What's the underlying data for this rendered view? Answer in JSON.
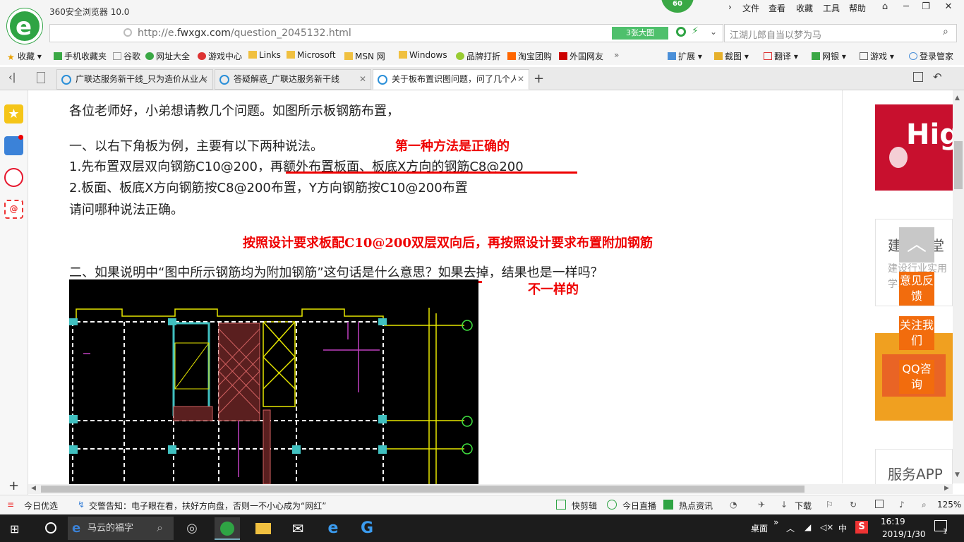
{
  "app": {
    "title": "360安全浏览器 10.0",
    "badge": "60"
  },
  "menu": [
    "文件",
    "查看",
    "收藏",
    "工具",
    "帮助"
  ],
  "address": {
    "url_prefix": "http://e.",
    "url_domain": "fwxgx.com",
    "url_path": "/question_2045132.html",
    "bigpic_label": "3张大图",
    "search_text": "江湖儿郎自当以梦为马"
  },
  "bookmarks": [
    "收藏",
    "手机收藏夹",
    "谷歌",
    "网址大全",
    "游戏中心",
    "Links",
    "Microsoft",
    "MSN 网",
    "Windows",
    "品牌打折",
    "淘宝团购",
    "外国网友"
  ],
  "toolbar_right": [
    "扩展",
    "截图",
    "翻译",
    "网银",
    "游戏",
    "登录管家"
  ],
  "tabs": [
    {
      "label": "广联达服务新干线_只为造价从业人"
    },
    {
      "label": "答疑解惑_广联达服务新干线"
    },
    {
      "label": "关于板布置识图问题，问了几个人"
    }
  ],
  "article": {
    "l1": "各位老师好，小弟想请教几个问题。如图所示板钢筋布置，",
    "l2": "一、以右下角板为例，主要有以下两种说法。",
    "l3": "1.先布置双层双向钢筋C10@200，再额外布置板面、板底X方向的钢筋C8@200",
    "l4": "2.板面、板底X方向钢筋按C8@200布置，Y方向钢筋按C10@200布置",
    "l5": "请问哪种说法正确。",
    "l6": "二、如果说明中“图中所示钢筋均为附加钢筋”这句话是什么意思？如果去掉，结果也是一样吗？"
  },
  "annotations": {
    "a1": "第一种方法是正确的",
    "a2": "按照设计要求板配C10@200双层双向后，再按照设计要求布置附加钢筋",
    "a3": "不一样的"
  },
  "right": {
    "card1": "建筑课堂",
    "card1_sub": "建设行业实用学习平台",
    "card3": "服务APP",
    "feedback": "意见反馈",
    "follow": "关注我们",
    "qq": "QQ咨询",
    "banner_text": "Hig"
  },
  "status": {
    "today": "今日优选",
    "news": "交警告知：电子眼在看，扶好方向盘，否则一不小心成为“网红”",
    "quickclip": "快剪辑",
    "live": "今日直播",
    "hot": "热点资讯",
    "download": "下载",
    "zoom": "125%"
  },
  "taskbar": {
    "search": "马云的福字",
    "desktop": "桌面",
    "ime": "中",
    "time": "16:19",
    "date": "2019/1/30",
    "notif": "1"
  },
  "colors": {
    "accent_green": "#2fa444",
    "annotation_red": "#e00000",
    "orange": "#f26c0d"
  }
}
